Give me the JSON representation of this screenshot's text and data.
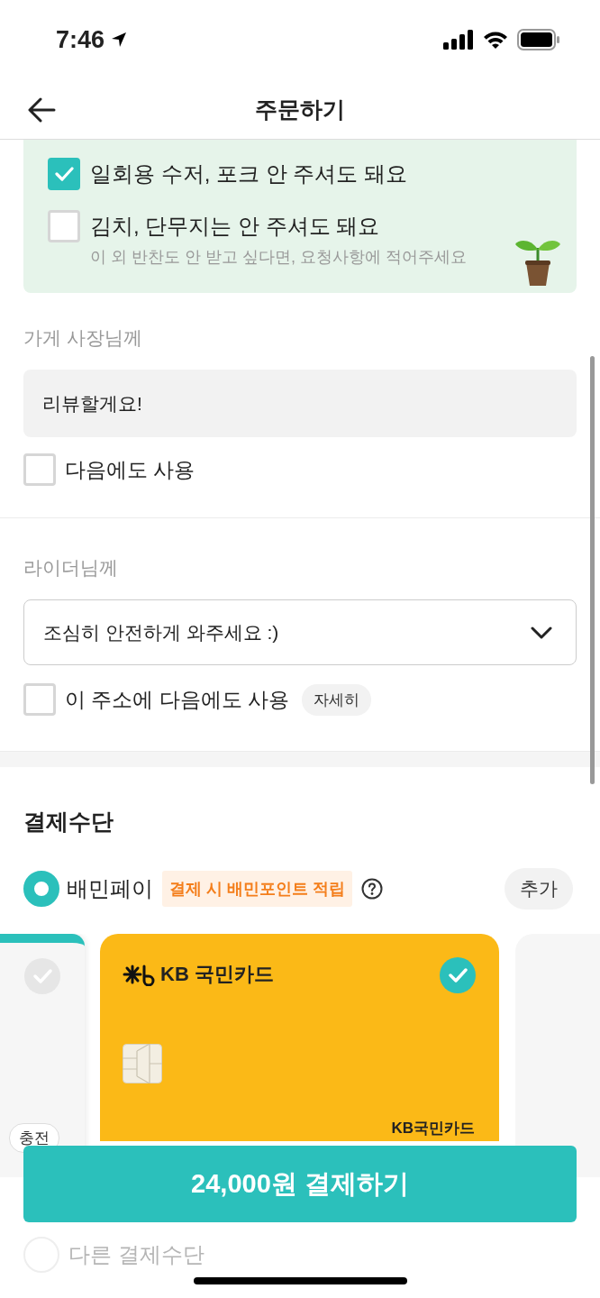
{
  "status_bar": {
    "time": "7:46"
  },
  "header": {
    "title": "주문하기"
  },
  "disposable_options": [
    {
      "label": "일회용 수저, 포크 안 주셔도 돼요",
      "checked": true
    },
    {
      "label": "김치, 단무지는 안 주셔도 돼요",
      "checked": false,
      "hint": "이 외 반찬도 안 받고 싶다면, 요청사항에 적어주세요"
    }
  ],
  "store_request": {
    "label": "가게 사장님께",
    "value": "리뷰할게요!",
    "reuse": {
      "label": "다음에도 사용",
      "checked": false
    }
  },
  "rider_request": {
    "label": "라이더님께",
    "value": "조심히 안전하게 와주세요 :)",
    "reuse": {
      "label": "이 주소에 다음에도 사용",
      "checked": false
    },
    "detail_button": "자세히"
  },
  "payment": {
    "title": "결제수단",
    "method": {
      "label": "배민페이",
      "selected": true,
      "promo": "결제 시 배민포인트 적립"
    },
    "add_button": "추가",
    "cards": [
      {
        "kind": "pay",
        "selected": false,
        "badge": "충전"
      },
      {
        "kind": "card",
        "selected": true,
        "issuer": "KB 국민카드",
        "footer": "KB국민카드"
      },
      {
        "kind": "blank"
      }
    ],
    "other_method": {
      "label": "다른 결제수단",
      "selected": false
    }
  },
  "pay_button": "24,000원 결제하기"
}
